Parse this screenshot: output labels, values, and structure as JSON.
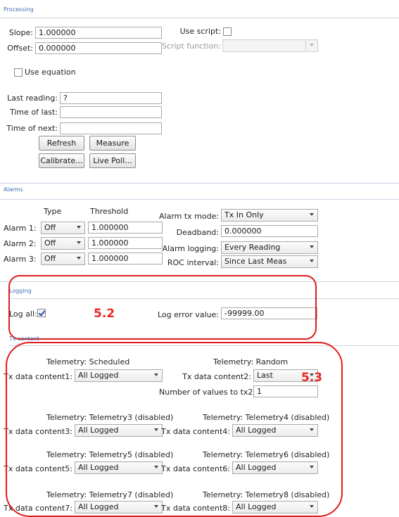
{
  "processing": {
    "title": "Processing",
    "slope_label": "Slope:",
    "slope_value": "1.000000",
    "offset_label": "Offset:",
    "offset_value": "0.000000",
    "use_script_label": "Use script:",
    "use_script_checked": false,
    "script_function_label": "Script function:",
    "script_function_value": "",
    "use_equation_label": "Use equation",
    "use_equation_checked": false,
    "last_reading_label": "Last reading:",
    "last_reading_value": "?",
    "time_of_last_label": "Time of last:",
    "time_of_last_value": "",
    "time_of_next_label": "Time of next:",
    "time_of_next_value": "",
    "buttons": {
      "refresh": "Refresh",
      "measure": "Measure",
      "calibrate": "Calibrate...",
      "live_poll": "Live Poll..."
    }
  },
  "alarms": {
    "title": "Alarms",
    "type_header": "Type",
    "threshold_header": "Threshold",
    "rows": [
      {
        "label": "Alarm 1:",
        "type": "Off",
        "threshold": "1.000000"
      },
      {
        "label": "Alarm 2:",
        "type": "Off",
        "threshold": "1.000000"
      },
      {
        "label": "Alarm 3:",
        "type": "Off",
        "threshold": "1.000000"
      }
    ],
    "tx_mode_label": "Alarm tx mode:",
    "tx_mode_value": "Tx In Only",
    "deadband_label": "Deadband:",
    "deadband_value": "0.000000",
    "logging_label": "Alarm logging:",
    "logging_value": "Every Reading",
    "roc_label": "ROC interval:",
    "roc_value": "Since Last Meas"
  },
  "logging": {
    "title": "Logging",
    "log_all_label": "Log all:",
    "log_all_checked": true,
    "error_value_label": "Log error value:",
    "error_value": "-99999.00"
  },
  "tx_content": {
    "title": "Tx content",
    "left": [
      {
        "telemetry": "Telemetry: Scheduled",
        "label": "Tx data content1:",
        "value": "All Logged"
      },
      {
        "telemetry": "Telemetry: Telemetry3 (disabled)",
        "label": "Tx data content3:",
        "value": "All Logged"
      },
      {
        "telemetry": "Telemetry: Telemetry5 (disabled)",
        "label": "Tx data content5:",
        "value": "All Logged"
      },
      {
        "telemetry": "Telemetry: Telemetry7 (disabled)",
        "label": "Tx data content7:",
        "value": "All Logged"
      }
    ],
    "right": [
      {
        "telemetry": "Telemetry: Random",
        "label": "Tx data content2:",
        "value": "Last"
      },
      {
        "telemetry": "Telemetry: Telemetry4 (disabled)",
        "label": "Tx data content4:",
        "value": "All Logged"
      },
      {
        "telemetry": "Telemetry: Telemetry6 (disabled)",
        "label": "Tx data content6:",
        "value": "All Logged"
      },
      {
        "telemetry": "Telemetry: Telemetry8 (disabled)",
        "label": "Tx data content8:",
        "value": "All Logged"
      }
    ],
    "num_values_label": "Number of values to tx2:",
    "num_values_value": "1"
  },
  "annotations": {
    "logging_tag": "5.2",
    "tx_tag": "5.3",
    "color": "#e8282b"
  }
}
